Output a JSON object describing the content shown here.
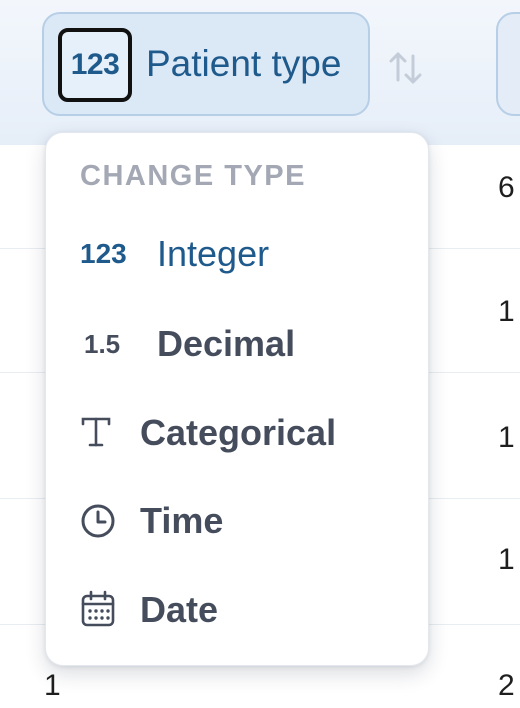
{
  "column_header": {
    "type_badge": "123",
    "label": "Patient type",
    "sort_icon": "sort-arrows-icon"
  },
  "table": {
    "right_column_values": [
      "6",
      "1",
      "1",
      "1",
      "2"
    ],
    "left_column_values": [
      "1"
    ]
  },
  "menu": {
    "heading": "CHANGE TYPE",
    "items": [
      {
        "glyph": "123",
        "label": "Integer",
        "selected": true
      },
      {
        "glyph": "1.5",
        "label": "Decimal",
        "selected": false
      },
      {
        "glyph": "T",
        "label": "Categorical",
        "selected": false,
        "icon": "text-type-icon"
      },
      {
        "glyph": "",
        "label": "Time",
        "selected": false,
        "icon": "clock-icon"
      },
      {
        "glyph": "",
        "label": "Date",
        "selected": false,
        "icon": "calendar-icon"
      }
    ]
  },
  "colors": {
    "accent": "#1f5a8c",
    "header_background": "#e6eef8",
    "menu_heading": "#a3a8b4",
    "item_text": "#454c5c"
  }
}
